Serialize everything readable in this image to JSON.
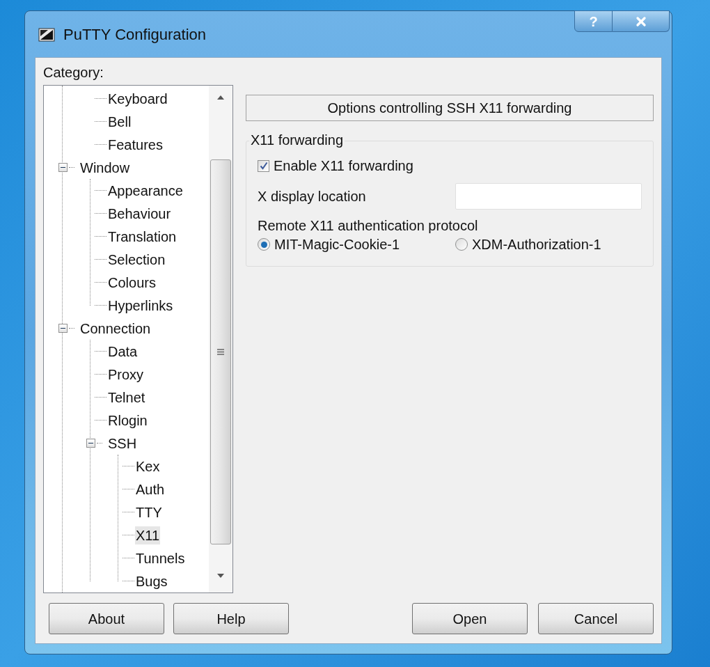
{
  "window": {
    "title": "PuTTY Configuration",
    "help_button": "?"
  },
  "category_label": "Category:",
  "tree": [
    {
      "children": [
        {
          "label": "Keyboard",
          "selected": false
        },
        {
          "label": "Bell",
          "selected": false
        },
        {
          "label": "Features",
          "selected": false
        }
      ]
    },
    {
      "label": "Window",
      "selected": false,
      "expanded": true,
      "children": [
        {
          "label": "Appearance",
          "selected": false
        },
        {
          "label": "Behaviour",
          "selected": false
        },
        {
          "label": "Translation",
          "selected": false
        },
        {
          "label": "Selection",
          "selected": false
        },
        {
          "label": "Colours",
          "selected": false
        },
        {
          "label": "Hyperlinks",
          "selected": false
        }
      ]
    },
    {
      "label": "Connection",
      "selected": false,
      "expanded": true,
      "children": [
        {
          "label": "Data",
          "selected": false
        },
        {
          "label": "Proxy",
          "selected": false
        },
        {
          "label": "Telnet",
          "selected": false
        },
        {
          "label": "Rlogin",
          "selected": false
        },
        {
          "label": "SSH",
          "selected": false,
          "expanded": true,
          "children": [
            {
              "label": "Kex",
              "selected": false
            },
            {
              "label": "Auth",
              "selected": false
            },
            {
              "label": "TTY",
              "selected": false
            },
            {
              "label": "X11",
              "selected": true
            },
            {
              "label": "Tunnels",
              "selected": false
            },
            {
              "label": "Bugs",
              "selected": false
            }
          ]
        }
      ]
    }
  ],
  "panel": {
    "header": "Options controlling SSH X11 forwarding",
    "group": {
      "title": "X11 forwarding",
      "checkbox": {
        "label": "Enable X11 forwarding",
        "checked": true
      },
      "field": {
        "label": "X display location"
      },
      "radio_label": "Remote X11 authentication protocol",
      "radios": [
        {
          "label": "MIT-Magic-Cookie-1",
          "selected": true
        },
        {
          "label": "XDM-Authorization-1",
          "selected": false
        }
      ]
    }
  },
  "left_buttons": [
    {
      "label": "About"
    },
    {
      "label": "Help"
    }
  ],
  "right_buttons": [
    {
      "label": "Open"
    },
    {
      "label": "Cancel"
    }
  ]
}
